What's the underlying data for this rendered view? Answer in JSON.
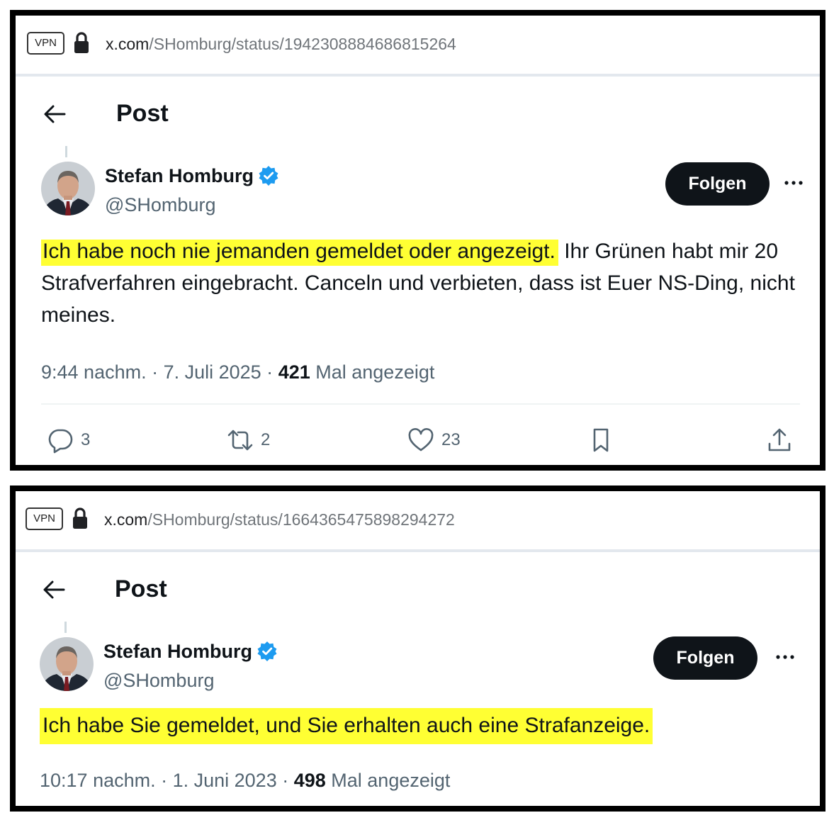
{
  "screens": [
    {
      "browser": {
        "vpn_label": "VPN",
        "url_host": "x.com",
        "url_path": "/SHomburg/status/1942308884686815264"
      },
      "header": {
        "title": "Post"
      },
      "author": {
        "name": "Stefan Homburg",
        "handle": "@SHomburg",
        "follow_label": "Folgen"
      },
      "tweet": {
        "highlighted_text": "Ich habe noch nie jemanden gemeldet oder angezeigt.",
        "rest_text": " Ihr Grünen habt mir 20 Strafverfahren eingebracht. Canceln und verbieten, dass ist Euer NS-Ding, nicht meines."
      },
      "meta": {
        "time_date": "9:44 nachm. · 7. Juli 2025 · ",
        "views": "421",
        "views_label": " Mal angezeigt"
      },
      "actions": {
        "replies": "3",
        "reposts": "2",
        "likes": "23"
      }
    },
    {
      "browser": {
        "vpn_label": "VPN",
        "url_host": "x.com",
        "url_path": "/SHomburg/status/1664365475898294272"
      },
      "header": {
        "title": "Post"
      },
      "author": {
        "name": "Stefan Homburg",
        "handle": "@SHomburg",
        "follow_label": "Folgen"
      },
      "tweet": {
        "highlighted_text": "Ich habe Sie gemeldet, und Sie erhalten auch eine Strafanzeige.",
        "rest_text": ""
      },
      "meta": {
        "time_date": "10:17 nachm. · 1. Juni 2023 · ",
        "views": "498",
        "views_label": " Mal angezeigt"
      }
    }
  ],
  "colors": {
    "highlight": "#ffff33",
    "follow_button": "#0f1419",
    "verified_badge": "#1d9bf0",
    "muted_text": "#536471",
    "frame_border": "#000000"
  },
  "icons": [
    "lock-icon",
    "back-arrow-icon",
    "verified-badge-icon",
    "more-icon",
    "reply-icon",
    "repost-icon",
    "like-icon",
    "bookmark-icon",
    "share-icon"
  ]
}
